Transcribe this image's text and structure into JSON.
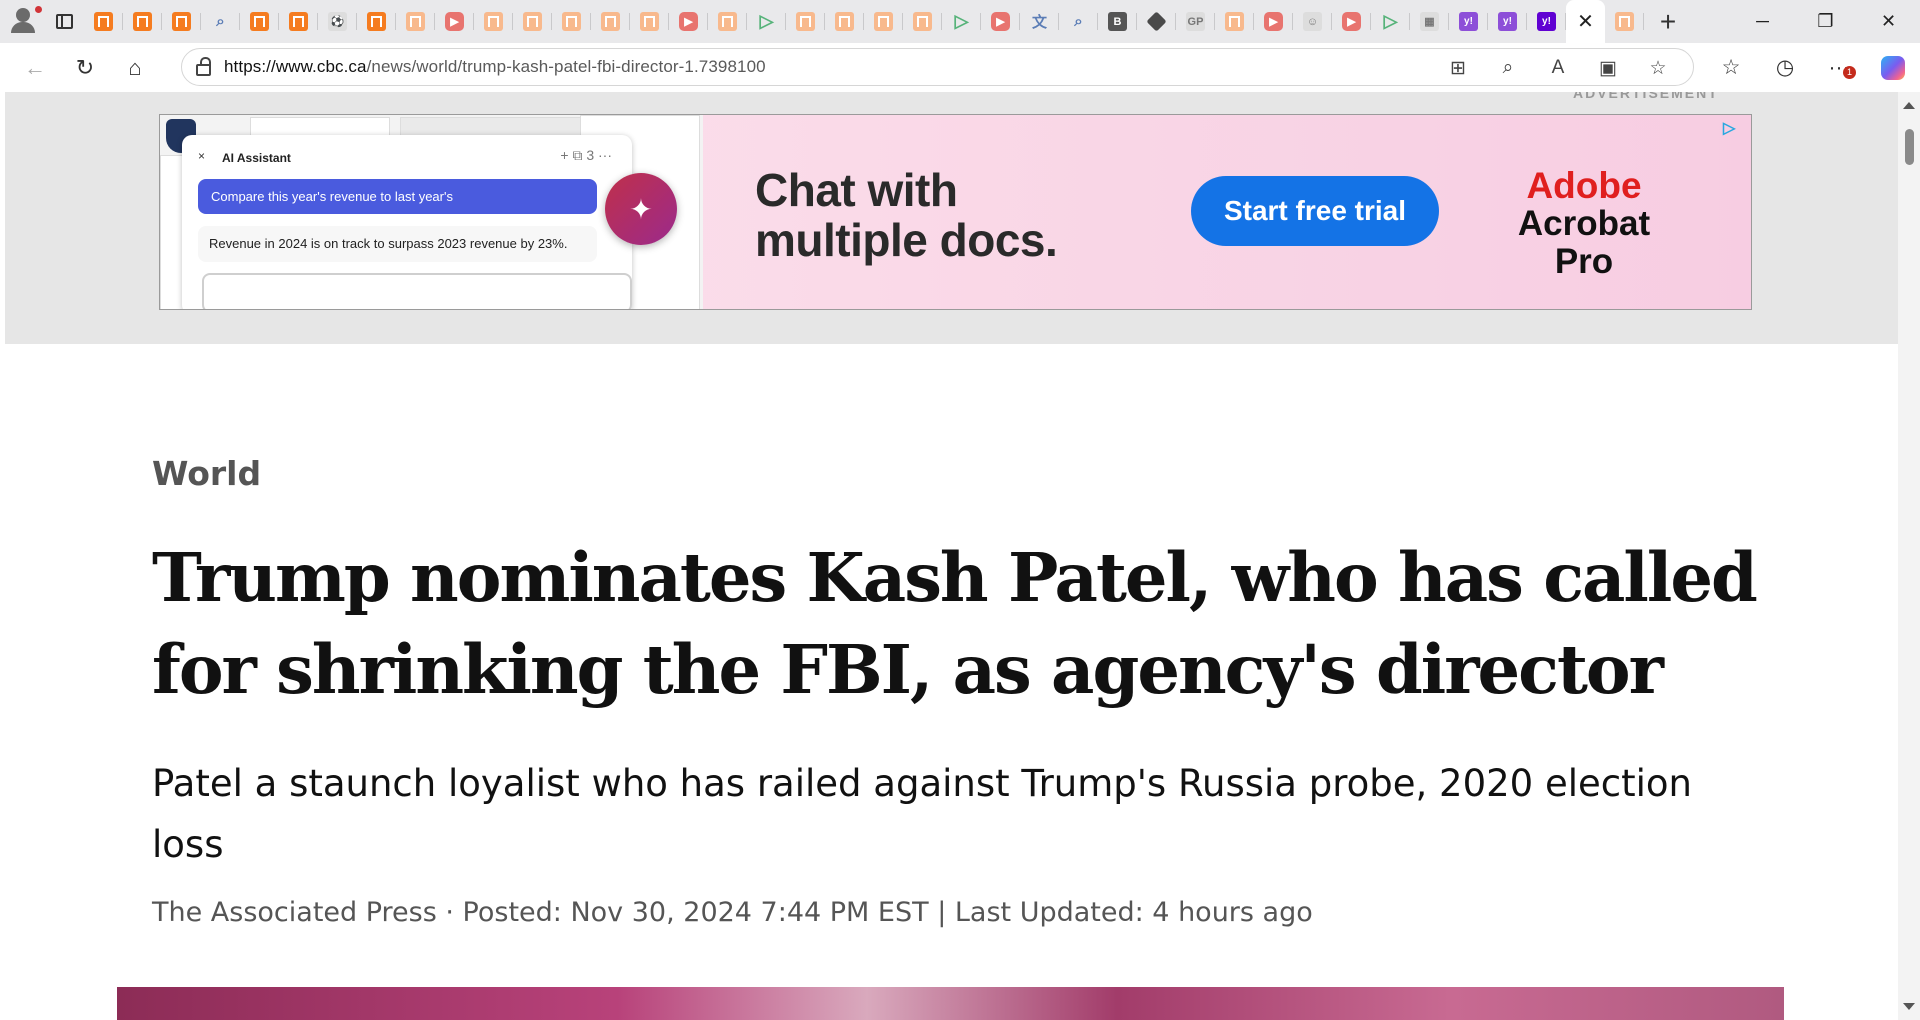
{
  "browser": {
    "pinned_tabs": [
      {
        "icon": "bookmark-orange-icon",
        "style": "orange",
        "glyph": ""
      },
      {
        "icon": "bookmark-orange-icon",
        "style": "orange",
        "glyph": ""
      },
      {
        "icon": "bookmark-orange-icon",
        "style": "orange",
        "glyph": ""
      },
      {
        "icon": "search-icon",
        "style": "blue",
        "glyph": "⌕"
      },
      {
        "icon": "bookmark-orange-icon",
        "style": "orange",
        "glyph": ""
      },
      {
        "icon": "bookmark-orange-icon",
        "style": "orange",
        "glyph": ""
      },
      {
        "icon": "soccer-icon",
        "style": "gray",
        "glyph": "⚽"
      },
      {
        "icon": "bookmark-orange-icon",
        "style": "orange",
        "glyph": ""
      },
      {
        "icon": "bookmark-peach-icon",
        "style": "peach",
        "glyph": ""
      },
      {
        "icon": "youtube-icon",
        "style": "red",
        "glyph": "▶"
      },
      {
        "icon": "bookmark-peach-icon",
        "style": "peach",
        "glyph": ""
      },
      {
        "icon": "bookmark-peach-icon",
        "style": "peach",
        "glyph": ""
      },
      {
        "icon": "bookmark-peach-icon",
        "style": "peach",
        "glyph": ""
      },
      {
        "icon": "bookmark-peach-icon",
        "style": "peach",
        "glyph": ""
      },
      {
        "icon": "bookmark-peach-icon",
        "style": "peach",
        "glyph": ""
      },
      {
        "icon": "youtube-icon",
        "style": "red",
        "glyph": "▶"
      },
      {
        "icon": "bookmark-peach-icon",
        "style": "peach",
        "glyph": ""
      },
      {
        "icon": "play-green-icon",
        "style": "green",
        "glyph": "▷"
      },
      {
        "icon": "bookmark-peach-icon",
        "style": "peach",
        "glyph": ""
      },
      {
        "icon": "bookmark-peach-icon",
        "style": "peach",
        "glyph": ""
      },
      {
        "icon": "bookmark-peach-icon",
        "style": "peach",
        "glyph": ""
      },
      {
        "icon": "bookmark-peach-icon",
        "style": "peach",
        "glyph": ""
      },
      {
        "icon": "play-green-icon",
        "style": "green",
        "glyph": "▷"
      },
      {
        "icon": "youtube-icon",
        "style": "red",
        "glyph": "▶"
      },
      {
        "icon": "translate-icon",
        "style": "blue",
        "glyph": "文"
      },
      {
        "icon": "search-icon",
        "style": "blue",
        "glyph": "⌕"
      },
      {
        "icon": "b-logo-icon",
        "style": "dark",
        "glyph": "B"
      },
      {
        "icon": "diamond-icon",
        "style": "dia",
        "glyph": ""
      },
      {
        "icon": "gp-icon",
        "style": "gray",
        "glyph": "GP"
      },
      {
        "icon": "b-logo-icon",
        "style": "peach",
        "glyph": ""
      },
      {
        "icon": "youtube-icon",
        "style": "red",
        "glyph": "▶"
      },
      {
        "icon": "robot-icon",
        "style": "gray",
        "glyph": "☺"
      },
      {
        "icon": "youtube-icon",
        "style": "red",
        "glyph": "▶"
      },
      {
        "icon": "play-green-icon",
        "style": "green",
        "glyph": "▷"
      },
      {
        "icon": "news-icon",
        "style": "gray",
        "glyph": "▦"
      },
      {
        "icon": "yahoo-icon",
        "style": "lilac",
        "glyph": "y!"
      },
      {
        "icon": "yahoo-icon",
        "style": "lilac",
        "glyph": "y!"
      },
      {
        "icon": "yahoo-icon",
        "style": "purple",
        "glyph": "y!"
      }
    ],
    "after_active_tab": [
      {
        "icon": "bookmark-peach-icon",
        "style": "peach",
        "glyph": ""
      }
    ],
    "active_tab_close": "✕",
    "new_tab": "+",
    "window_controls": {
      "minimize": "─",
      "restore": "❐",
      "close": "✕"
    },
    "url_domain": "https://www.cbc.ca",
    "url_path": "/news/world/trump-kash-patel-fbi-director-1.7398100",
    "notification_count": "1"
  },
  "ad": {
    "label": "ADVERTISEMENT",
    "assistant_title": "AI Assistant",
    "assistant_close": "×",
    "assistant_tools": "+ ⧉ 3 ···",
    "question": "Compare this year's revenue to last year's",
    "answer": "Revenue in 2024 is on track to surpass 2023 revenue by 23%.",
    "headline": "Chat with multiple docs.",
    "cta": "Start free trial",
    "brand_line1": "Adobe",
    "brand_line2": "Acrobat Pro"
  },
  "article": {
    "section": "World",
    "headline": "Trump nominates Kash Patel, who has called for shrinking the FBI, as agency's director",
    "deck": "Patel a staunch loyalist who has railed against Trump's Russia probe, 2020 election loss",
    "byline": "The Associated Press · Posted: Nov 30, 2024 7:44 PM EST | Last Updated: 4 hours ago"
  }
}
